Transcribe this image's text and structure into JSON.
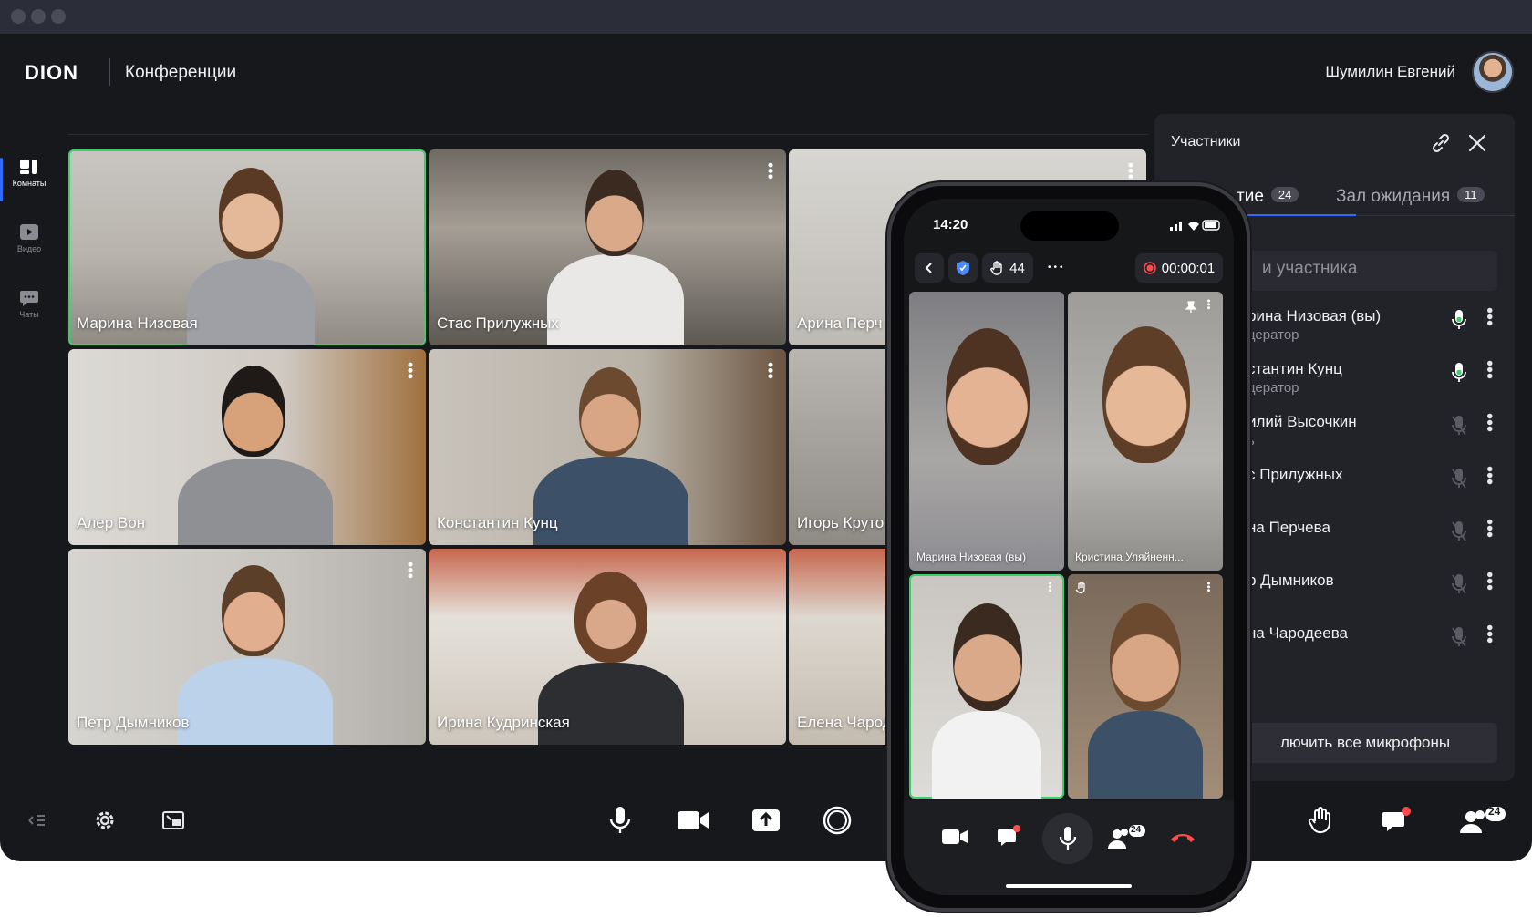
{
  "app": {
    "logo": "DION",
    "title": "Конференции",
    "user_name": "Шумилин Евгений"
  },
  "nav": [
    {
      "label": "Комнаты",
      "icon": "rooms-icon",
      "active": true
    },
    {
      "label": "Видео",
      "icon": "video-play-icon",
      "active": false
    },
    {
      "label": "Чаты",
      "icon": "chat-icon",
      "active": false
    }
  ],
  "tiles": [
    {
      "name": "Марина Низовая",
      "speaking": true
    },
    {
      "name": "Стас Прилужных",
      "speaking": false
    },
    {
      "name": "Арина Перч",
      "speaking": false
    },
    {
      "name": "Алер Вон",
      "speaking": false
    },
    {
      "name": "Константин Кунц",
      "speaking": false
    },
    {
      "name": "Игорь Круто",
      "speaking": false
    },
    {
      "name": "Петр Дымников",
      "speaking": false
    },
    {
      "name": "Ирина Кудринская",
      "speaking": false
    },
    {
      "name": "Елена Чарод",
      "speaking": false
    }
  ],
  "panel": {
    "title": "Участники",
    "tab_event": "тие",
    "tab_event_count": "24",
    "tab_waiting": "Зал ожидания",
    "tab_waiting_count": "11",
    "search_placeholder": "и участника",
    "participants": [
      {
        "name": "рина Низовая (вы)",
        "role": "цератор",
        "mic": "on"
      },
      {
        "name": "стантин Кунц",
        "role": "цератор",
        "mic": "on"
      },
      {
        "name": "илий Высочкин",
        "role": "ь",
        "mic": "off"
      },
      {
        "name": "с Прилужных",
        "role": "",
        "mic": "off"
      },
      {
        "name": "на Перчева",
        "role": "",
        "mic": "off"
      },
      {
        "name": "р Дымников",
        "role": "",
        "mic": "off"
      },
      {
        "name": "на Чародеева",
        "role": "",
        "mic": "off"
      }
    ],
    "mute_all": "лючить все микрофоны"
  },
  "bottom_right": {
    "participants_badge": "24"
  },
  "phone": {
    "time": "14:20",
    "hands_count": "44",
    "timer": "00:00:01",
    "tiles": [
      {
        "name": "Марина Низовая (вы)"
      },
      {
        "name": "Кристина Уляйненн..."
      },
      {
        "name": ""
      },
      {
        "name": ""
      }
    ],
    "participants_badge": "24"
  },
  "colors": {
    "background": "#17181c",
    "panel": "#222329",
    "accent": "#2f6bff",
    "speaking": "#3ccf6a",
    "hangup": "#ff4b4b"
  }
}
